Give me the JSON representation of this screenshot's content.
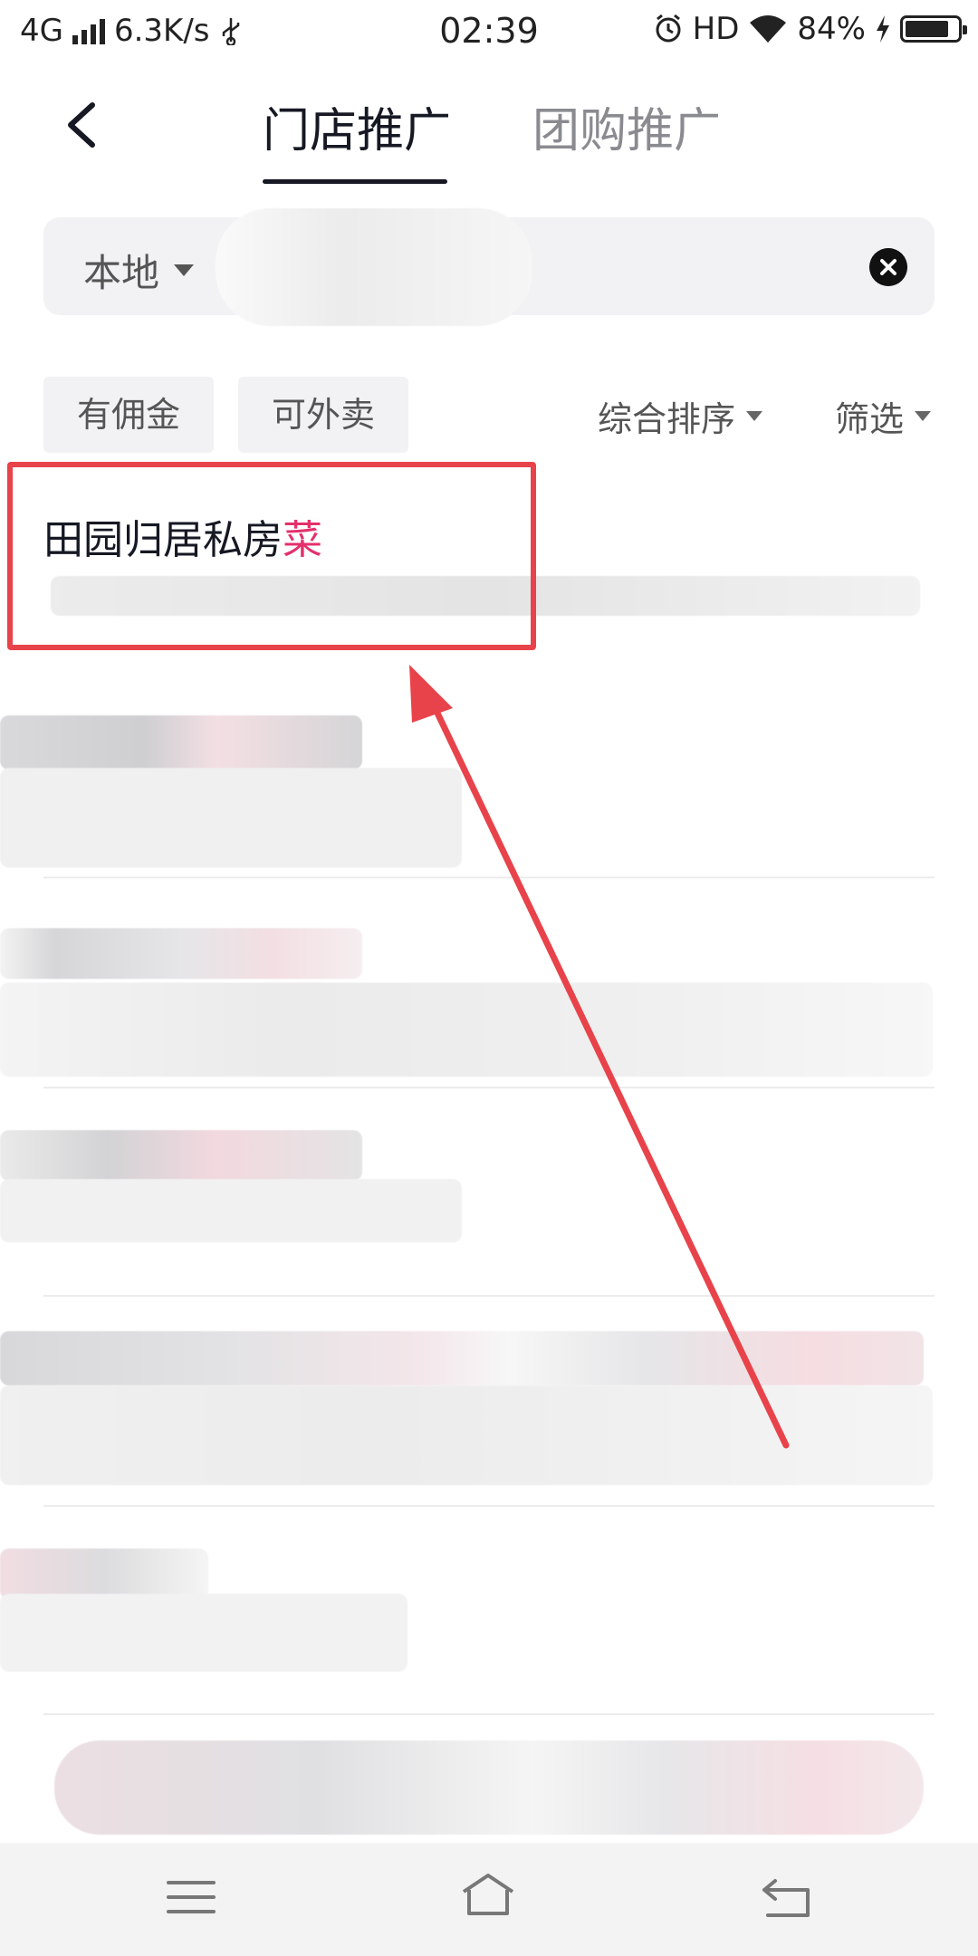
{
  "status_bar": {
    "network": "4G",
    "speed": "6.3K/s",
    "usb_icon": "usb-icon",
    "time": "02:39",
    "hd": "HD",
    "battery": "84%",
    "battery_level": 0.84
  },
  "header": {
    "tabs": [
      {
        "label": "门店推广",
        "active": true
      },
      {
        "label": "团购推广",
        "active": false
      }
    ]
  },
  "search": {
    "region": "本地",
    "value": ""
  },
  "filters": {
    "chips": [
      "有佣金",
      "可外卖"
    ],
    "sort_label": "综合排序",
    "filter_label": "筛选"
  },
  "results": [
    {
      "name_prefix": "田园归居私房",
      "name_highlight": "菜"
    }
  ],
  "colors": {
    "highlight": "#e4306a",
    "annotation": "#e8434a"
  }
}
